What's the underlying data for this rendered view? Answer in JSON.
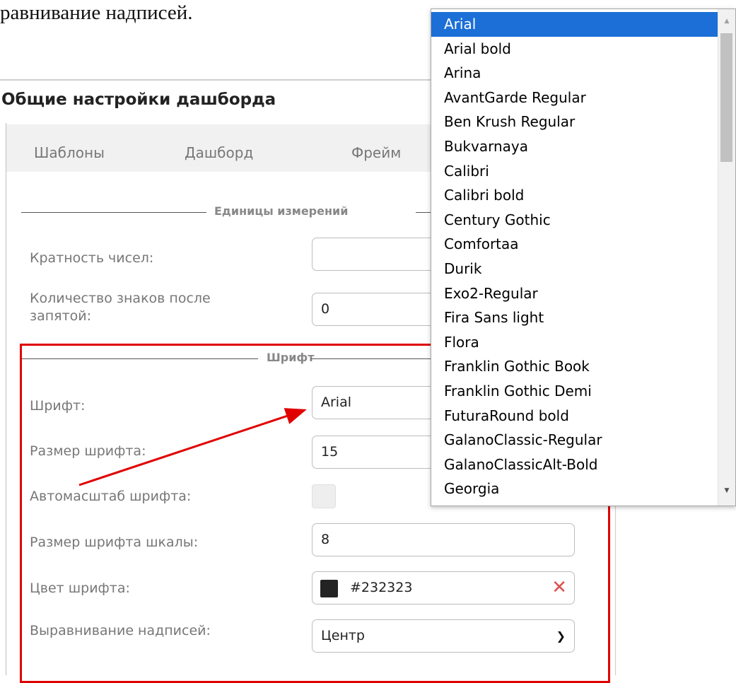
{
  "doc": {
    "heading_fragment": "равнивание надписей."
  },
  "panel": {
    "title": "Общие настройки дашборда",
    "tabs": [
      "Шаблоны",
      "Дашборд",
      "Фрейм"
    ]
  },
  "units_section": {
    "legend": "Единицы измерений",
    "multiplicity_label": "Кратность чисел:",
    "multiplicity_value": "",
    "decimals_label_line1": "Количество знаков после",
    "decimals_label_line2": "запятой:",
    "decimals_value": "0"
  },
  "font_section": {
    "legend": "Шрифт",
    "font_label": "Шрифт:",
    "font_value": "Arial",
    "size_label": "Размер шрифта:",
    "size_value": "15",
    "autoscale_label": "Автомасштаб шрифта:",
    "autoscale_checked": false,
    "scale_size_label": "Размер шрифта шкалы:",
    "scale_size_value": "8",
    "color_label": "Цвет шрифта:",
    "color_value": "#232323",
    "align_label": "Выравнивание надписей:",
    "align_value": "Центр"
  },
  "font_dropdown": {
    "selected": "Arial",
    "options": [
      "Arial",
      "Arial bold",
      "Arina",
      "AvantGarde Regular",
      "Ben Krush Regular",
      "Bukvarnaya",
      "Calibri",
      "Calibri bold",
      "Century Gothic",
      "Comfortaa",
      "Durik",
      "Exo2-Regular",
      "Fira Sans light",
      "Flora",
      "Franklin Gothic Book",
      "Franklin Gothic Demi",
      "FuturaRound bold",
      "GalanoClassic-Regular",
      "GalanoClassicAlt-Bold",
      "Georgia"
    ]
  },
  "colors": {
    "selected_bg": "#1b6fd6",
    "annotation_red": "#e00000",
    "font_color_swatch": "#232323"
  }
}
